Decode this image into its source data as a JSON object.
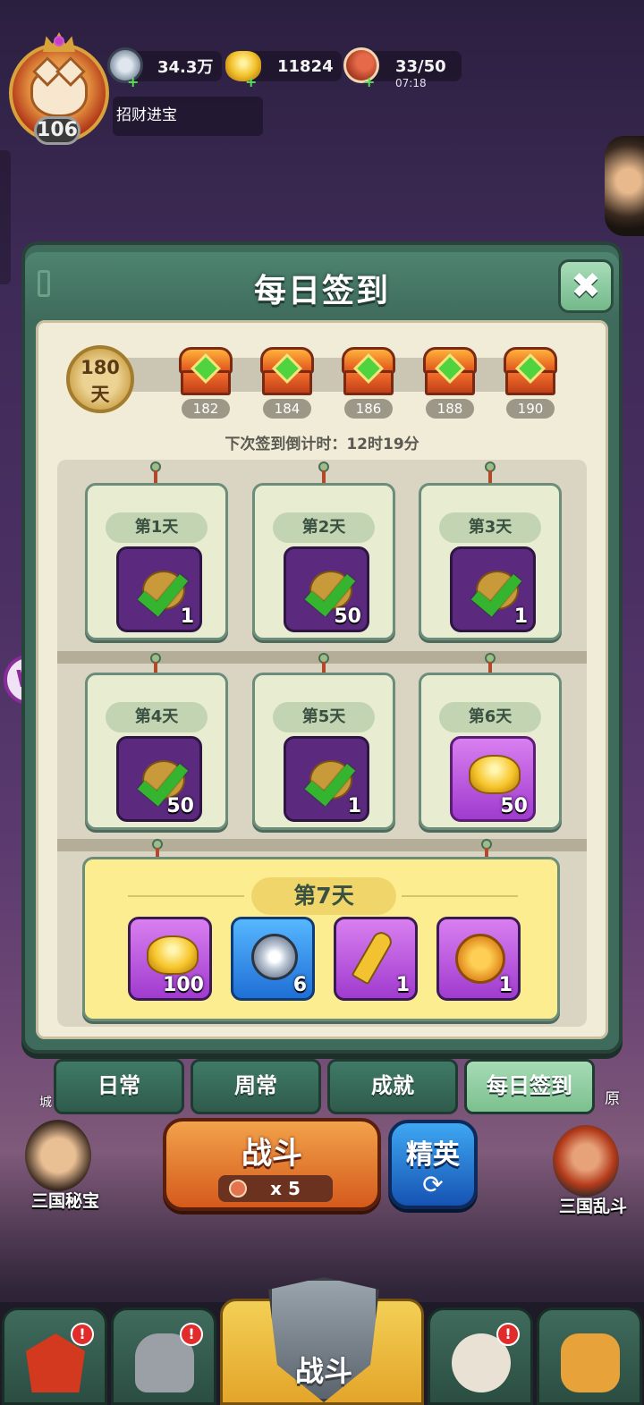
{
  "hud": {
    "level": "106",
    "title": "招财进宝",
    "silver": "34.3万",
    "gold": "11824",
    "stamina": "33/50",
    "stamina_timer": "07:18"
  },
  "dialog": {
    "title": "每日签到",
    "close_symbol": "✖",
    "current_days_num": "180",
    "current_days_unit": "天",
    "milestones": [
      "182",
      "184",
      "186",
      "188",
      "190"
    ],
    "countdown": "下次签到倒计时：12时19分",
    "days": [
      {
        "label": "第1天",
        "count": "1",
        "icon": "check-icon"
      },
      {
        "label": "第2天",
        "count": "50",
        "icon": "check-icon"
      },
      {
        "label": "第3天",
        "count": "1",
        "icon": "check-icon"
      },
      {
        "label": "第4天",
        "count": "50",
        "icon": "check-icon"
      },
      {
        "label": "第5天",
        "count": "1",
        "icon": "check-icon"
      },
      {
        "label": "第6天",
        "count": "50",
        "icon": "gold-ingot-icon"
      }
    ],
    "day7": {
      "label": "第7天",
      "rewards": [
        {
          "count": "100",
          "icon": "gold-ingot-icon"
        },
        {
          "count": "6",
          "icon": "silver-coin-icon"
        },
        {
          "count": "1",
          "icon": "key-icon"
        },
        {
          "count": "1",
          "icon": "medal-icon"
        }
      ]
    }
  },
  "tabs": [
    "日常",
    "周常",
    "成就",
    "每日签到"
  ],
  "actions": {
    "fight": "战斗",
    "fight_cost": "x 5",
    "elite": "精英",
    "elite_refresh": "⟳"
  },
  "npcs": {
    "left": "三国秘宝",
    "right": "三国乱斗",
    "wall": "城",
    "plain": "原"
  },
  "nav": {
    "center": "战斗",
    "badge": "!"
  },
  "side": {
    "w_label": "W"
  },
  "colors": {
    "panel": "#3f6b5c",
    "fight": "#d55a1c",
    "elite": "#1653b3",
    "day7": "#fcee90"
  }
}
